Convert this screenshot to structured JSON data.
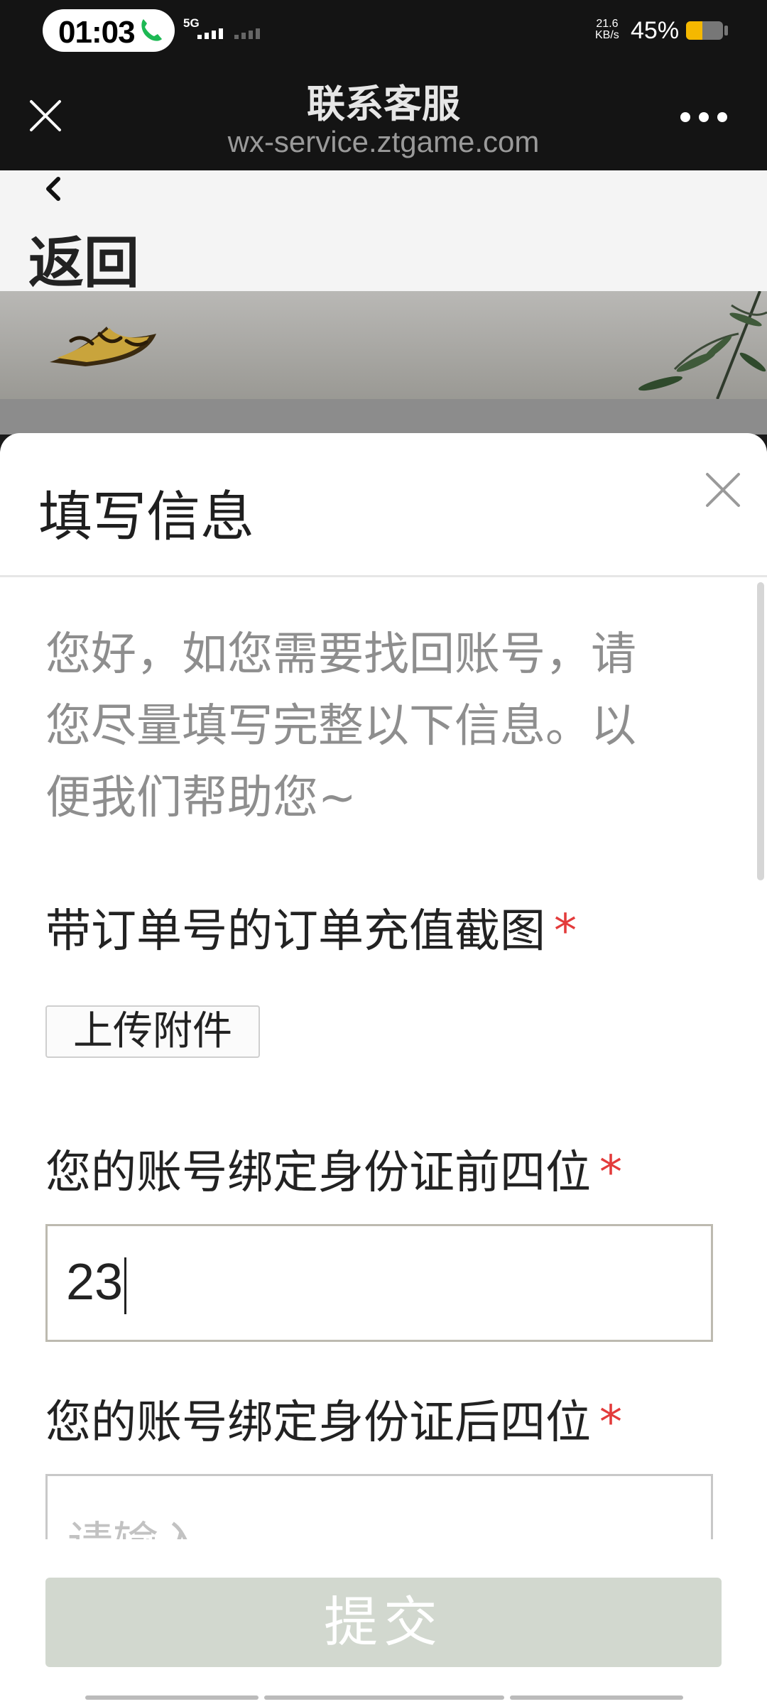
{
  "status_bar": {
    "time": "01:03",
    "network": "5G",
    "speed_value": "21.6",
    "speed_unit": "KB/s",
    "battery_percent": "45%",
    "battery_level": 0.45,
    "battery_color": "#f5b800",
    "call_icon_color": "#1db954"
  },
  "browser": {
    "title": "联系客服",
    "url": "wx-service.ztgame.com",
    "close_icon": "close-icon",
    "more_icon": "more-dots-icon"
  },
  "page": {
    "back_label": "返回",
    "back_icon": "chevron-left-icon"
  },
  "modal": {
    "title": "填写信息",
    "close_icon": "close-icon",
    "intro": "您好，如您需要找回账号，请您尽量填写完整以下信息。以便我们帮助您~",
    "fields": [
      {
        "label": "带订单号的订单充值截图",
        "required_mark": "*",
        "button_label": "上传附件"
      },
      {
        "label": "您的账号绑定身份证前四位",
        "required_mark": "*",
        "value": "23"
      },
      {
        "label": "您的账号绑定身份证后四位",
        "required_mark": "*",
        "placeholder": "请输入"
      }
    ],
    "submit_label": "提交",
    "required_color": "#e33b3b"
  }
}
